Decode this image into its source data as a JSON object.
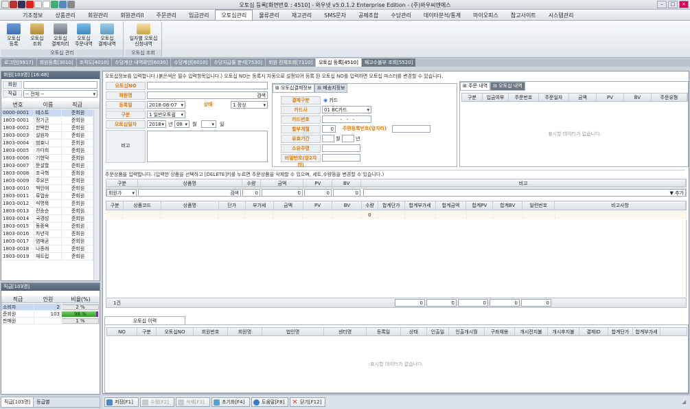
{
  "window": {
    "title": "오토십 등록[화면번호 : 4510] - 와우넷 v5.0.1.2 Enterprise Edition - (주)와우씨엔에스"
  },
  "menu": [
    "기초정보",
    "상품관리",
    "회원관리",
    "회원관리II",
    "주문관리",
    "입금관리",
    "오토십관리",
    "물류관리",
    "재고관리",
    "SMS문자",
    "공제조합",
    "수당관리",
    "데이터분석/통계",
    "마이오피스",
    "참고사이트",
    "시스템관리"
  ],
  "ribbon": {
    "group1": {
      "label": "오토십 관리",
      "buttons": [
        "오토십\n등록",
        "오토십\n조회",
        "오토십\n결제처리",
        "오토십\n주문내역",
        "오토십\n결제내역"
      ]
    },
    "group2": {
      "label": "오토십 조회",
      "buttons": [
        "일자별 오토십\n신청내역"
      ]
    }
  },
  "tabs": [
    "로그인[9917]",
    "회원등록[3010]",
    "조직도[4010]",
    "수당계산 내역확인[6030]",
    "수당계산[6010]",
    "수당지급률 분석[7530]",
    "회원 전체조회[7110]",
    "오토십 등록[4510]",
    "재고수불부 조회[5520]"
  ],
  "member_panel": {
    "header": "회원[103명] [16:48]",
    "search_label": "회원",
    "rank_label": "직급",
    "rank_value": "-- 전체 --",
    "columns": [
      "번호",
      "이름",
      "직급"
    ],
    "rows": [
      [
        "0000-0001",
        "테스트",
        "준회원"
      ],
      [
        "1803-0001",
        "정기근",
        "준회원"
      ],
      [
        "1803-0002",
        "한택헌",
        "준회원"
      ],
      [
        "1803-0003",
        "설원자",
        "준회원"
      ],
      [
        "1803-0004",
        "범효니",
        "준회원"
      ],
      [
        "1803-0005",
        "가다희",
        "준회원"
      ],
      [
        "1803-0006",
        "기현덕",
        "준회원"
      ],
      [
        "1803-0007",
        "문설할",
        "준회원"
      ],
      [
        "1803-0008",
        "조극혁",
        "준회원"
      ],
      [
        "1803-0009",
        "주요은",
        "준회원"
      ],
      [
        "1803-0010",
        "백인애",
        "준회원"
      ],
      [
        "1803-0011",
        "류업송",
        "준회원"
      ],
      [
        "1803-0012",
        "석명욱",
        "준회원"
      ],
      [
        "1803-0013",
        "전송순",
        "준회원"
      ],
      [
        "1803-0014",
        "국경성",
        "준회원"
      ],
      [
        "1803-0015",
        "동종옥",
        "준회원"
      ],
      [
        "1803-0016",
        "차년각",
        "준회원"
      ],
      [
        "1803-0017",
        "염매균",
        "준회원"
      ],
      [
        "1803-0018",
        "나종래",
        "준회원"
      ],
      [
        "1803-0019",
        "채트립",
        "준회원"
      ]
    ]
  },
  "rank_panel": {
    "header": "직급[103명]",
    "columns": [
      "직급",
      "인원",
      "비율(%)"
    ],
    "rows": [
      {
        "rank": "소비자",
        "count": "2",
        "pct": "2 %",
        "fill": 0.02
      },
      {
        "rank": "준회원",
        "count": "103",
        "pct": "98 %",
        "fill": 0.98
      },
      {
        "rank": "판매원",
        "count": "",
        "pct": "1 %",
        "fill": 0.01
      }
    ],
    "bottom_tabs": [
      "직급[103명]",
      "등급별"
    ]
  },
  "autoship_form": {
    "notice": "오토십정보를 입력합니다.(붉은색은 필수 입력항목입니다.) 오토십 NO는 등록시 자동으로 설정되어 등록 된 오토십 NO를 입력하면 오토십 마스터를 변경할 수 있습니다.",
    "autoship_no_label": "오토십NO",
    "member_label": "회원명",
    "search_btn": "검색",
    "reg_date_label": "등록일",
    "reg_date": "2018-08-07",
    "status_label": "상태",
    "status": "1 정상",
    "type_label": "구분",
    "type": "1 일반오토쉽",
    "autoship_date_label": "오토십일자",
    "year": "2018",
    "year_unit": "년",
    "month": "08",
    "month_unit": "월",
    "day_unit": "일",
    "memo_label": "비고"
  },
  "payment": {
    "tabs": [
      "오토십결제정보",
      "배송지정보"
    ],
    "payment_type_label": "결제구분",
    "payment_type": "카드",
    "card_company_label": "카드사",
    "card_company": "01 BC카드",
    "card_no_label": "카드번호",
    "card_no": "-   -   -",
    "installment_label": "할부개월",
    "installment": "0",
    "resident_label": "주민등록번호(앞자리)",
    "valid_label": "유효기간",
    "valid_month_unit": "월",
    "valid_year_unit": "년",
    "owner_label": "소유주명",
    "password_label": "비밀번호(앞2자리)"
  },
  "order_history": {
    "tabs": [
      "주문 내역",
      "오토십 내역"
    ],
    "columns": [
      "구분",
      "입금여부",
      "주문번호",
      "주문일자",
      "금액",
      "PV",
      "BV",
      "주문유형"
    ],
    "empty": "표시할 데이터가 없습니다."
  },
  "products": {
    "notice": "주문상품을 입력합니다. (입력한 상품을 선택하고 [DELETE]키를 누르면 주문상품을 삭제할 수 있으며, 세트,수량등을 변경할 수 있습니다.)",
    "input_headers": [
      "구분",
      "상품명",
      "수량",
      "금액",
      "PV",
      "BV",
      "비고"
    ],
    "input_values": {
      "type": "회원가",
      "search": "검색",
      "qty": "0",
      "amount": "0",
      "pv": "0",
      "bv": "0",
      "add": "▼ 추가"
    },
    "columns": [
      "구분",
      "상품코드",
      "상품명",
      "단가",
      "부가세",
      "금액",
      "PV",
      "BV",
      "수량",
      "합계단가",
      "합계부가세",
      "합계금액",
      "합계PV",
      "합계BV",
      "일련번호",
      "비고사항"
    ],
    "first_row_qty": "0",
    "footer_count": "1건",
    "footer_totals": [
      "0",
      "0",
      "0",
      "0",
      "0"
    ]
  },
  "autoship_history": {
    "tab": "오토십 이력",
    "columns": [
      "NO",
      "구분",
      "오토십NO",
      "회원번호",
      "회원명",
      "법인명",
      "센터명",
      "등록일",
      "상태",
      "인출일",
      "인출개시월",
      "구좌채용",
      "개시전지불",
      "개시후지불",
      "결제ID",
      "합계단가",
      "합계부가세"
    ],
    "empty": "표시할 데이터가 없습니다."
  },
  "statusbar": {
    "buttons": [
      "저장[F1]",
      "수정[F2]",
      "삭제[F3]",
      "초기화[F4]",
      "도움말[F8]",
      "닫기[F12]"
    ]
  }
}
